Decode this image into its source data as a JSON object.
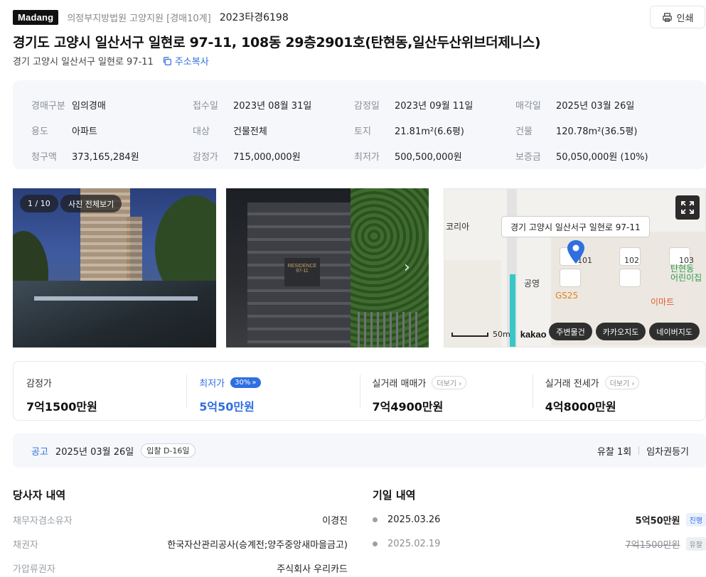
{
  "header": {
    "logo": "Madang",
    "court": "의정부지방법원 고양지원 [경매10계]",
    "case_no": "2023타경6198",
    "print_label": "인쇄"
  },
  "property": {
    "title": "경기도 고양시 일산서구 일현로 97-11, 108동 29층2901호(탄현동,일산두산위브더제니스)",
    "address": "경기 고양시 일산서구 일현로 97-11",
    "copy_label": "주소복사"
  },
  "info": [
    {
      "k": "경매구분",
      "v": "임의경매"
    },
    {
      "k": "접수일",
      "v": "2023년 08월 31일"
    },
    {
      "k": "감정일",
      "v": "2023년 09월 11일"
    },
    {
      "k": "매각일",
      "v": "2025년 03월 26일"
    },
    {
      "k": "용도",
      "v": "아파트"
    },
    {
      "k": "대상",
      "v": "건물전체"
    },
    {
      "k": "토지",
      "v": "21.81m²(6.6평)"
    },
    {
      "k": "건물",
      "v": "120.78m²(36.5평)"
    },
    {
      "k": "청구액",
      "v": "373,165,284원"
    },
    {
      "k": "감정가",
      "v": "715,000,000원"
    },
    {
      "k": "최저가",
      "v": "500,500,000원"
    },
    {
      "k": "보증금",
      "v": "50,050,000원 (10%)"
    }
  ],
  "photos": {
    "counter": "1 / 10",
    "view_all": "사진 전체보기",
    "sign_text": "RESIDENCE 97-11"
  },
  "map": {
    "tooltip": "경기 고양시 일산서구 일현로 97-11",
    "labels": {
      "korea": "코리아",
      "gongyeong": "공영",
      "gs25": "GS25",
      "kindergarten": "탄현동\n어린이집",
      "emart": "이마트",
      "dongs": [
        "101",
        "102",
        "103"
      ]
    },
    "scale": "50m",
    "brand": "kakao",
    "buttons": [
      "주변물건",
      "카카오지도",
      "네이버지도"
    ]
  },
  "prices": {
    "appraisal_label": "감정가",
    "appraisal_value": "7억1500만원",
    "min_label": "최저가",
    "min_pct": "30%",
    "min_value": "5억50만원",
    "trade_label": "실거래 매매가",
    "trade_value": "7억4900만원",
    "jeonse_label": "실거래 전세가",
    "jeonse_value": "4억8000만원",
    "more_label": "더보기"
  },
  "notice": {
    "tag": "공고",
    "date": "2025년 03월 26일",
    "dday": "입찰 D-16일",
    "fail_count": "유찰 1회",
    "lease": "임차권등기"
  },
  "parties": {
    "title": "당사자 내역",
    "rows": [
      {
        "k": "채무자겸소유자",
        "v": "이경진"
      },
      {
        "k": "채권자",
        "v": "한국자산관리공사(승계전;양주중앙새마을금고)"
      },
      {
        "k": "가압류권자",
        "v": "주식회사 우리카드"
      }
    ]
  },
  "history": {
    "title": "기일 내역",
    "rows": [
      {
        "date": "2025.03.26",
        "price": "5억50만원",
        "status": "진행"
      },
      {
        "date": "2025.02.19",
        "price": "7억1500만원",
        "status": "유찰"
      }
    ]
  },
  "colors": {
    "accent": "#2f6fe0",
    "panel": "#f5f7fa"
  }
}
